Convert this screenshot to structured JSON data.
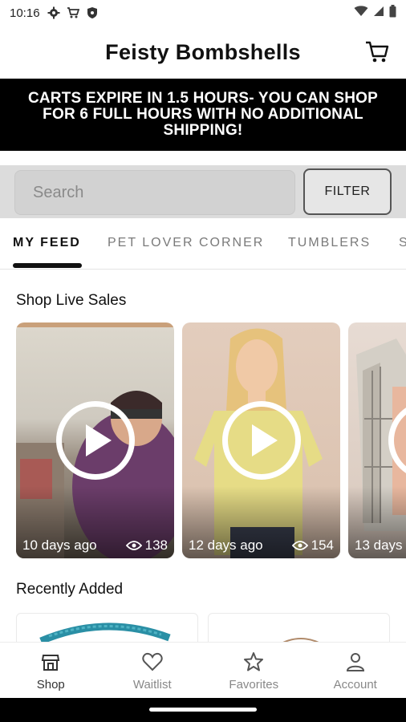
{
  "status_bar": {
    "time": "10:16"
  },
  "header": {
    "title": "Feisty Bombshells"
  },
  "banner": {
    "text": "CARTS EXPIRE IN 1.5 HOURS- YOU CAN SHOP FOR 6 FULL HOURS WITH NO ADDITIONAL SHIPPING!"
  },
  "search": {
    "placeholder": "Search",
    "filter_label": "FILTER"
  },
  "tabs": [
    {
      "label": "MY FEED",
      "active": true
    },
    {
      "label": "PET LOVER CORNER",
      "active": false
    },
    {
      "label": "TUMBLERS",
      "active": false
    },
    {
      "label": "S",
      "active": false
    }
  ],
  "live_sales": {
    "title": "Shop Live Sales",
    "cards": [
      {
        "time_ago": "10 days ago",
        "views": "138"
      },
      {
        "time_ago": "12 days ago",
        "views": "154"
      },
      {
        "time_ago": "13 days",
        "views": ""
      }
    ]
  },
  "recently_added": {
    "title": "Recently Added"
  },
  "bottom_nav": [
    {
      "label": "Shop",
      "icon": "shop-icon",
      "active": true
    },
    {
      "label": "Waitlist",
      "icon": "heart-icon",
      "active": false
    },
    {
      "label": "Favorites",
      "icon": "star-icon",
      "active": false
    },
    {
      "label": "Account",
      "icon": "person-icon",
      "active": false
    }
  ],
  "colors": {
    "banner_bg": "#000000",
    "search_bg": "#dcdcdc",
    "active_tab": "#111111"
  }
}
